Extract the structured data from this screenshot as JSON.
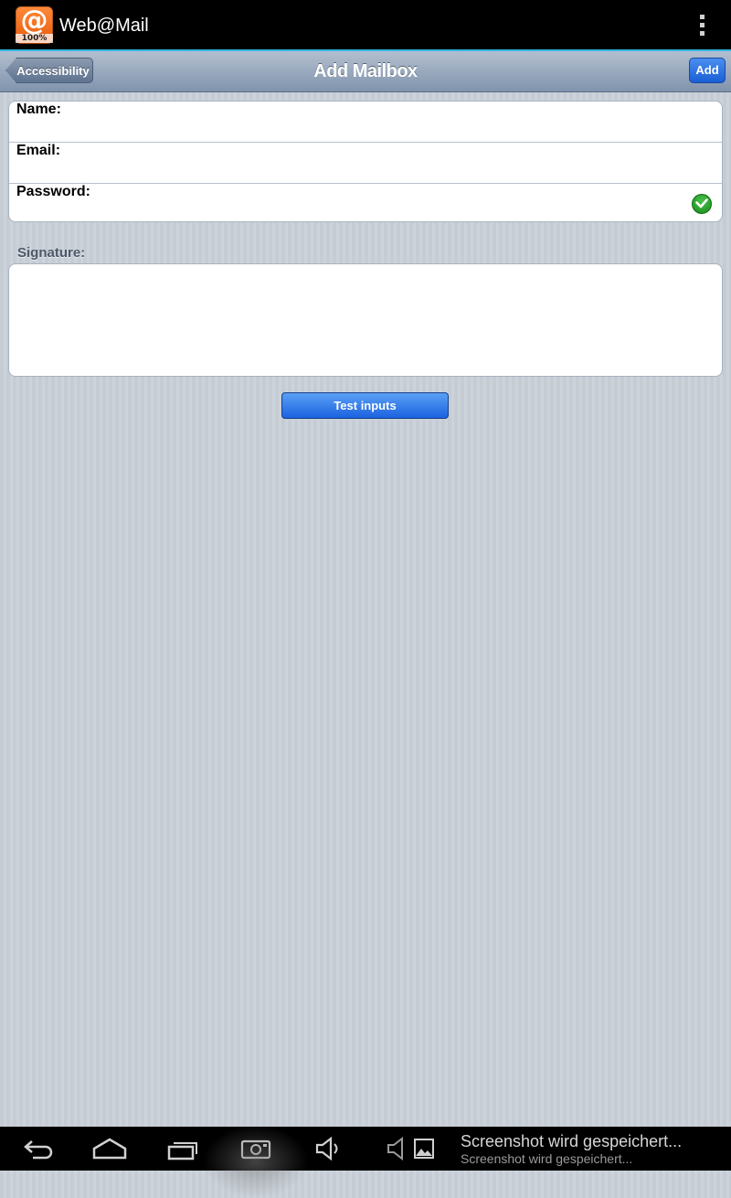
{
  "actionbar": {
    "app_title": "Web@Mail",
    "icon_glyph": "@",
    "icon_badge": "100%",
    "icon": "app-logo-icon",
    "overflow_icon": "overflow-menu-icon"
  },
  "navbar": {
    "back_label": "Accessibility",
    "title": "Add Mailbox",
    "add_label": "Add"
  },
  "form": {
    "name_label": "Name:",
    "name_value": "",
    "email_label": "Email:",
    "email_value": "",
    "password_label": "Password:",
    "password_value": "",
    "password_status_icon": "green-check-icon"
  },
  "signature": {
    "label": "Signature:",
    "value": ""
  },
  "test_button_label": "Test inputs",
  "system_bar": {
    "notification_title": "Screenshot wird gespeichert...",
    "notification_subtitle": "Screenshot wird gespeichert...",
    "icons": [
      "back-icon",
      "home-icon",
      "recent-apps-icon",
      "screenshot-icon",
      "volume-down-icon",
      "volume-up-icon",
      "gallery-icon"
    ]
  },
  "colors": {
    "accent_blue": "#1b62e0",
    "holo_blue": "#33b5e5",
    "nav_gradient_top": "#b3bfcf",
    "nav_gradient_bottom": "#8094ad",
    "check_green": "#188a1d"
  }
}
